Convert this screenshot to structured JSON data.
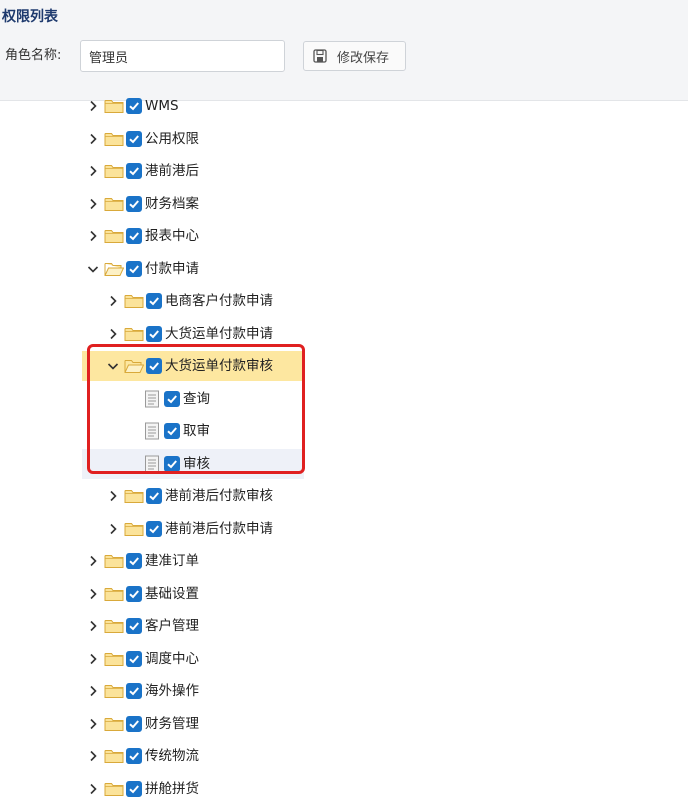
{
  "header": {
    "title": "权限列表",
    "role_label": "角色名称:",
    "role_value": "管理员",
    "save_label": "修改保存"
  },
  "colors": {
    "accent": "#1a73c8",
    "title": "#1e3a6e",
    "selected_row": "#fde7a0",
    "hover_row": "#eef1f8",
    "annotation": "#e02020"
  },
  "tree": [
    {
      "label": "WMS",
      "level": 0,
      "type": "folder",
      "expanded": false,
      "checked": true
    },
    {
      "label": "公用权限",
      "level": 0,
      "type": "folder",
      "expanded": false,
      "checked": true
    },
    {
      "label": "港前港后",
      "level": 0,
      "type": "folder",
      "expanded": false,
      "checked": true
    },
    {
      "label": "财务档案",
      "level": 0,
      "type": "folder",
      "expanded": false,
      "checked": true
    },
    {
      "label": "报表中心",
      "level": 0,
      "type": "folder",
      "expanded": false,
      "checked": true
    },
    {
      "label": "付款申请",
      "level": 0,
      "type": "folder",
      "expanded": true,
      "checked": true
    },
    {
      "label": "电商客户付款申请",
      "level": 1,
      "type": "folder",
      "expanded": false,
      "checked": true
    },
    {
      "label": "大货运单付款申请",
      "level": 1,
      "type": "folder",
      "expanded": false,
      "checked": true
    },
    {
      "label": "大货运单付款审核",
      "level": 1,
      "type": "folder",
      "expanded": true,
      "checked": true,
      "selected": true
    },
    {
      "label": "查询",
      "level": 2,
      "type": "file",
      "checked": true
    },
    {
      "label": "取审",
      "level": 2,
      "type": "file",
      "checked": true
    },
    {
      "label": "审核",
      "level": 2,
      "type": "file",
      "checked": true,
      "hovered": true
    },
    {
      "label": "港前港后付款审核",
      "level": 1,
      "type": "folder",
      "expanded": false,
      "checked": true
    },
    {
      "label": "港前港后付款申请",
      "level": 1,
      "type": "folder",
      "expanded": false,
      "checked": true
    },
    {
      "label": "建准订单",
      "level": 0,
      "type": "folder",
      "expanded": false,
      "checked": true
    },
    {
      "label": "基础设置",
      "level": 0,
      "type": "folder",
      "expanded": false,
      "checked": true
    },
    {
      "label": "客户管理",
      "level": 0,
      "type": "folder",
      "expanded": false,
      "checked": true
    },
    {
      "label": "调度中心",
      "level": 0,
      "type": "folder",
      "expanded": false,
      "checked": true
    },
    {
      "label": "海外操作",
      "level": 0,
      "type": "folder",
      "expanded": false,
      "checked": true
    },
    {
      "label": "财务管理",
      "level": 0,
      "type": "folder",
      "expanded": false,
      "checked": true
    },
    {
      "label": "传统物流",
      "level": 0,
      "type": "folder",
      "expanded": false,
      "checked": true
    },
    {
      "label": "拼舱拼货",
      "level": 0,
      "type": "folder",
      "expanded": false,
      "checked": true
    }
  ]
}
